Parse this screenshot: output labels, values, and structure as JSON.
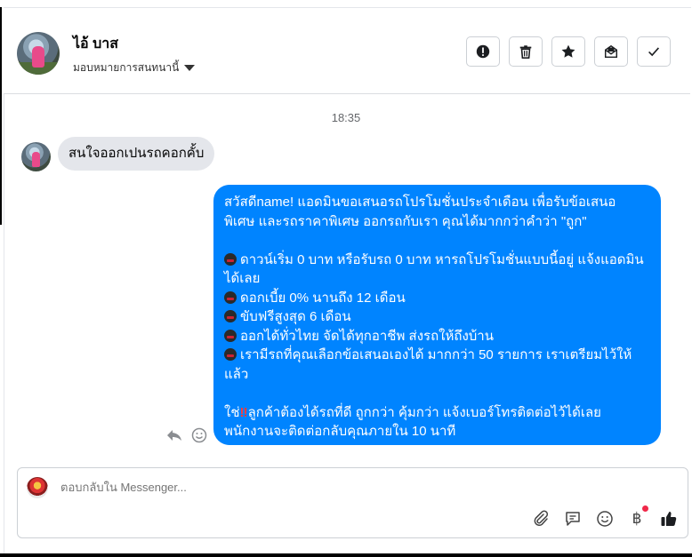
{
  "header": {
    "contact_name": "ไอ้ บาส",
    "assign_label": "มอบหมายการสนทนานี้",
    "buttons": [
      {
        "name": "report-button",
        "icon": "exclamation-circle-icon"
      },
      {
        "name": "delete-button",
        "icon": "trash-icon"
      },
      {
        "name": "star-button",
        "icon": "star-icon"
      },
      {
        "name": "mark-unread-button",
        "icon": "envelope-icon"
      },
      {
        "name": "mark-done-button",
        "icon": "check-icon"
      }
    ]
  },
  "chat": {
    "timestamp": "18:35",
    "received_message": "สนใจออกเปนรถคอกคั้บ",
    "sent_message": {
      "lines": [
        "สวัสดีname! แอดมินขอเสนอรถโปรโมชั่นประจำเดือน เพื่อรับข้อเสนอ",
        "พิเศษ และรถราคาพิเศษ ออกรถกับเรา คุณได้มากกว่าคำว่า \"ถูก\"",
        "",
        "ดาวน์เริ่ม 0 บาท หรือรับรถ 0 บาท หารถโปรโมชั่นแบบนี้อยู่ แจ้งแอดมิน",
        "ได้เลย",
        "ดอกเบี้ย 0% นานถึง 12 เดือน",
        "ขับฟรีสูงสุด 6 เดือน",
        "ออกได้ทั่วไทย จัดได้ทุกอาชีพ ส่งรถให้ถึงบ้าน",
        "เรามีรถที่คุณเลือกข้อเสนอเองได้ มากกว่า 50 รายการ เราเตรียมไว้ให้",
        "แล้ว",
        "",
        "ใช่",
        "ลูกค้าต้องได้รถที่ดี ถูกกว่า คุ้มกว่า แจ้งเบอร์โทรติดต่อไว้ได้เลย",
        "พนักงานจะติดต่อกลับคุณภายใน 10 นาที"
      ],
      "emoji_bullet": "car-emoji",
      "exclaim": "‼"
    },
    "message_actions": [
      "reply-icon",
      "smiley-icon"
    ]
  },
  "composer": {
    "placeholder": "ตอบกลับใน Messenger...",
    "tools": [
      "paperclip-icon",
      "saved-replies-icon",
      "emoji-icon",
      "baht-icon",
      "thumbs-up-icon"
    ],
    "baht_symbol": "฿"
  },
  "colors": {
    "sent_bubble": "#0084ff",
    "received_bubble": "#e4e6eb",
    "notification_dot": "#f02849"
  }
}
